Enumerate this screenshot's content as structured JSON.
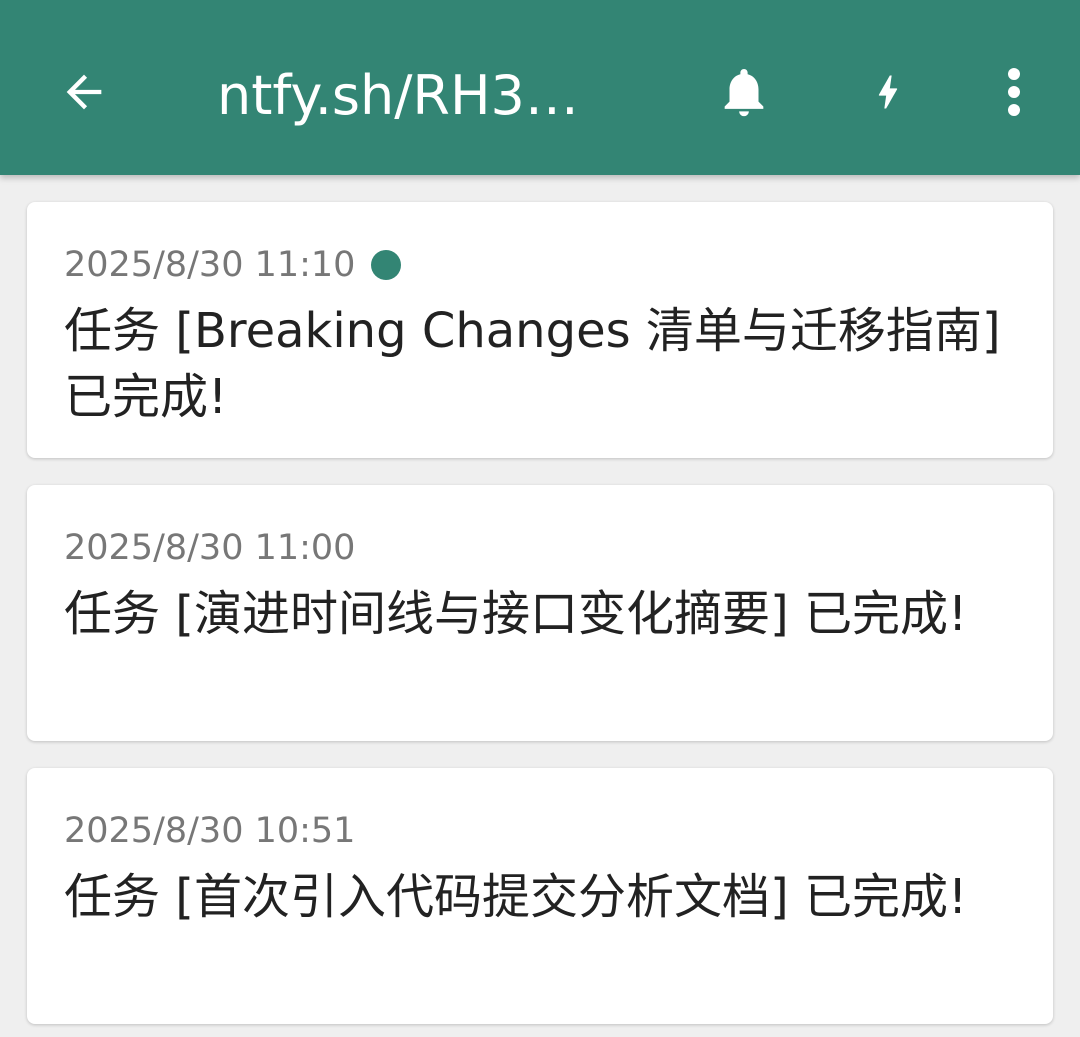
{
  "colors": {
    "app_bar": "#338574",
    "background": "#efefef",
    "card": "#ffffff",
    "accent_dot": "#338574",
    "time_text": "#777777",
    "message_text": "#222222"
  },
  "app_bar": {
    "title": "ntfy.sh/RH3…",
    "icons": [
      "back-arrow-icon",
      "bell-icon",
      "bolt-icon",
      "more-vert-icon"
    ]
  },
  "notifications": [
    {
      "time": "2025/8/30 11:10",
      "is_new": true,
      "message": "任务 [Breaking Changes 清单与迁移指南] 已完成!"
    },
    {
      "time": "2025/8/30 11:00",
      "is_new": false,
      "message": "任务 [演进时间线与接口变化摘要] 已完成!"
    },
    {
      "time": "2025/8/30 10:51",
      "is_new": false,
      "message": "任务 [首次引入代码提交分析文档] 已完成!"
    }
  ]
}
